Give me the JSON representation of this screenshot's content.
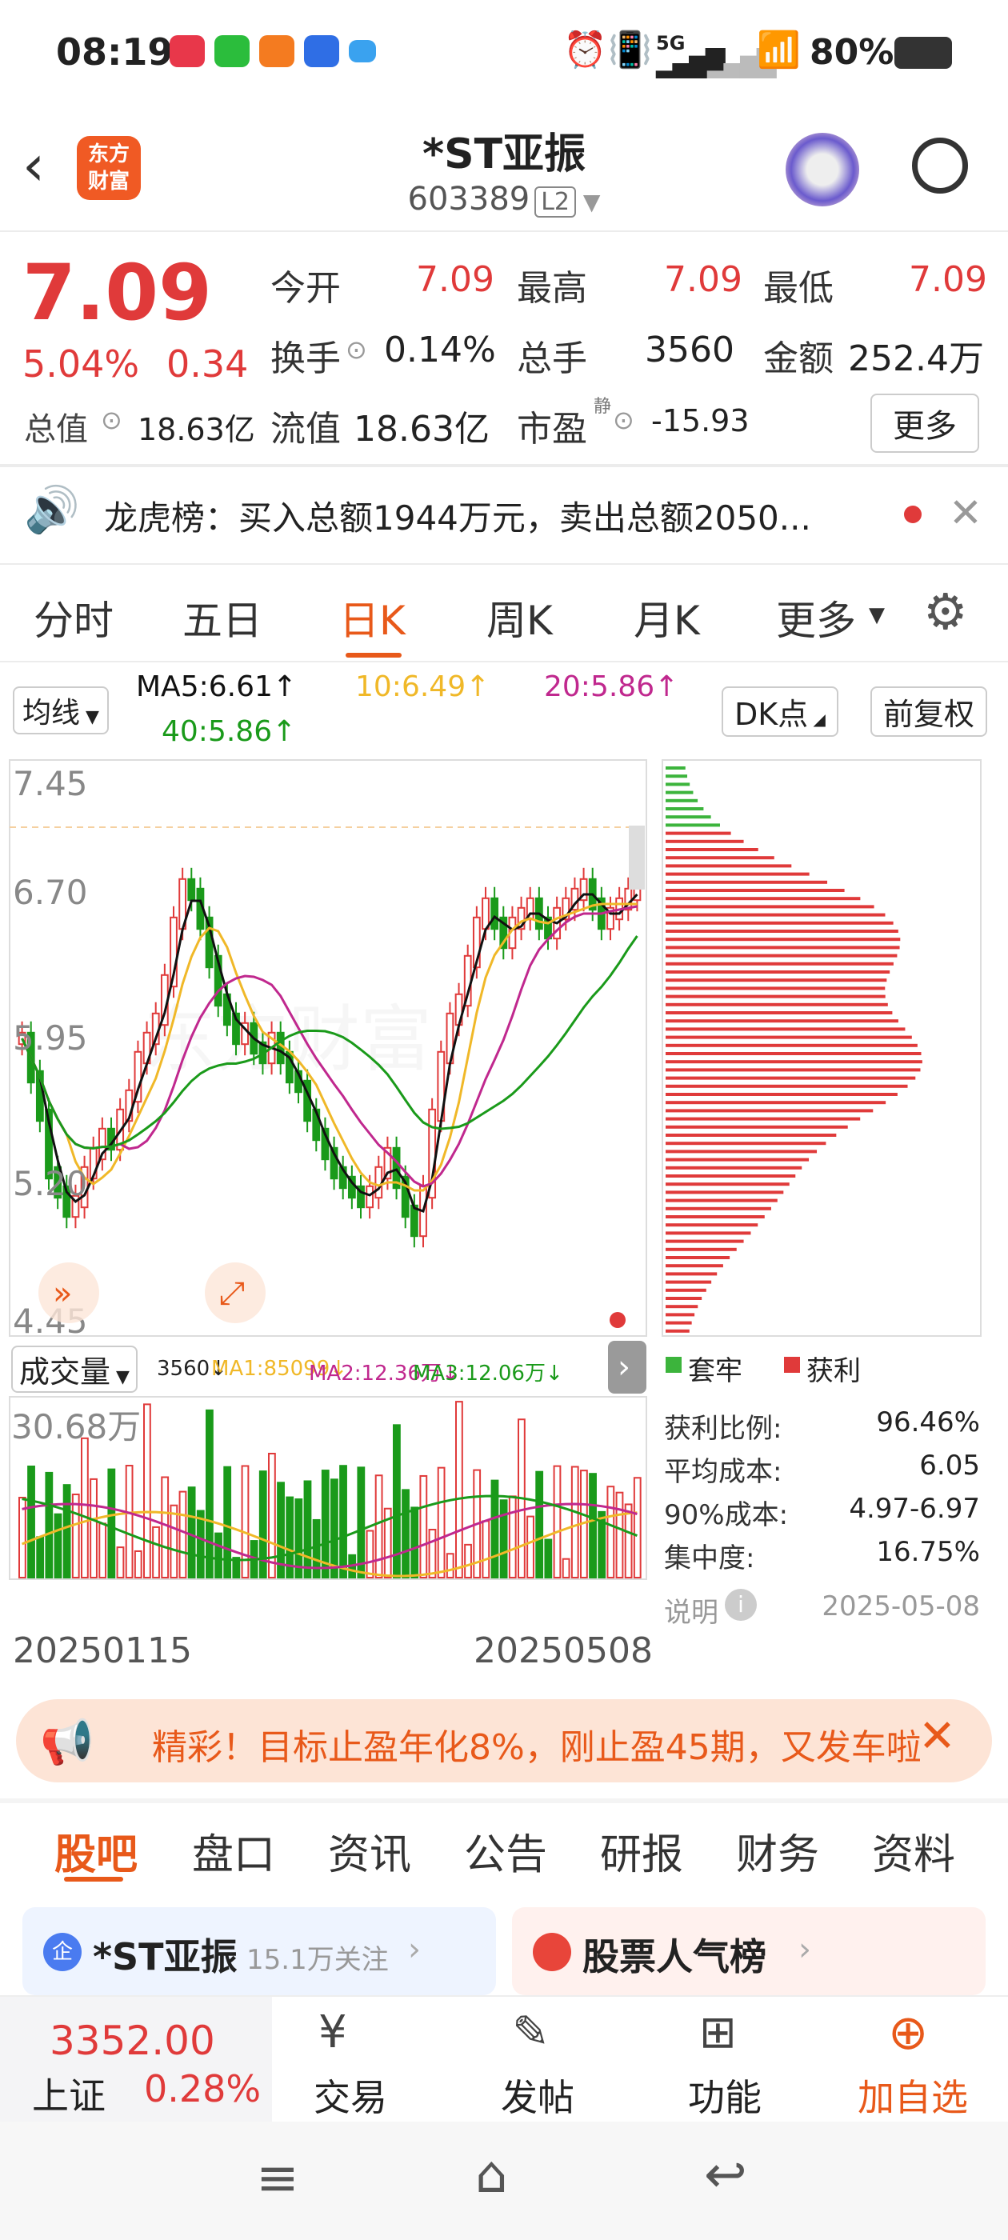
{
  "status": {
    "time": "08:19",
    "battery": "80%",
    "network": "5G"
  },
  "header": {
    "title": "*ST亚振",
    "code": "603389",
    "level": "L2",
    "logo_text": "东方\n财富"
  },
  "quote": {
    "price": "7.09",
    "change_pct": "5.04%",
    "change": "0.34",
    "open_label": "今开",
    "open": "7.09",
    "high_label": "最高",
    "high": "7.09",
    "low_label": "最低",
    "low": "7.09",
    "turnover_label": "换手",
    "turnover": "0.14%",
    "volume_label": "总手",
    "volume": "3560",
    "amount_label": "金额",
    "amount": "252.4万",
    "mktcap_label": "总值",
    "mktcap": "18.63亿",
    "float_label": "流值",
    "float": "18.63亿",
    "pe_label": "市盈",
    "pe_sup": "静",
    "pe": "-15.93",
    "more": "更多"
  },
  "notice": {
    "text": "龙虎榜：买入总额1944万元，卖出总额2050..."
  },
  "chart_tabs": [
    "分时",
    "五日",
    "日K",
    "周K",
    "月K",
    "更多"
  ],
  "chart_tab_active": "日K",
  "kline": {
    "indicator": "均线",
    "ma5": "MA5:6.61↑",
    "ma10": "10:6.49↑",
    "ma20": "20:5.86↑",
    "ma40": "40:5.86↑",
    "dk": "DK点",
    "adjust": "前复权",
    "y_ticks": [
      "7.45",
      "6.70",
      "5.95",
      "5.20",
      "4.45"
    ],
    "vol_label": "成交量",
    "vol_now": "3560↓",
    "vol_ma1": "MA1:85099↓",
    "vol_ma2": "MA2:12.36万↓",
    "vol_ma3": "MA3:12.06万↓",
    "vol_max": "30.68万",
    "date_start": "20250115",
    "date_end": "20250508"
  },
  "chips": {
    "legend_loss": "套牢",
    "legend_profit": "获利",
    "profit_ratio_label": "获利比例:",
    "profit_ratio": "96.46%",
    "avg_cost_label": "平均成本:",
    "avg_cost": "6.05",
    "cost90_label": "90%成本:",
    "cost90": "4.97-6.97",
    "concentration_label": "集中度:",
    "concentration": "16.75%",
    "explain": "说明",
    "date": "2025-05-08"
  },
  "promo": {
    "text": "精彩！目标止盈年化8%，刚止盈45期，又发车啦"
  },
  "bottom_tabs": [
    "股吧",
    "盘口",
    "资讯",
    "公告",
    "研报",
    "财务",
    "资料"
  ],
  "bottom_tab_active": "股吧",
  "cards": {
    "stock": "*ST亚振",
    "followers": "15.1万关注",
    "rank": "股票人气榜",
    "badge": "企"
  },
  "nav": {
    "index_value": "3352.00",
    "index_name": "上证",
    "index_pct": "0.28%",
    "trade": "交易",
    "post": "发帖",
    "func": "功能",
    "add": "加自选"
  },
  "colors": {
    "up": "#e03a3a",
    "down": "#1a9a1a",
    "accent": "#e8591a"
  }
}
